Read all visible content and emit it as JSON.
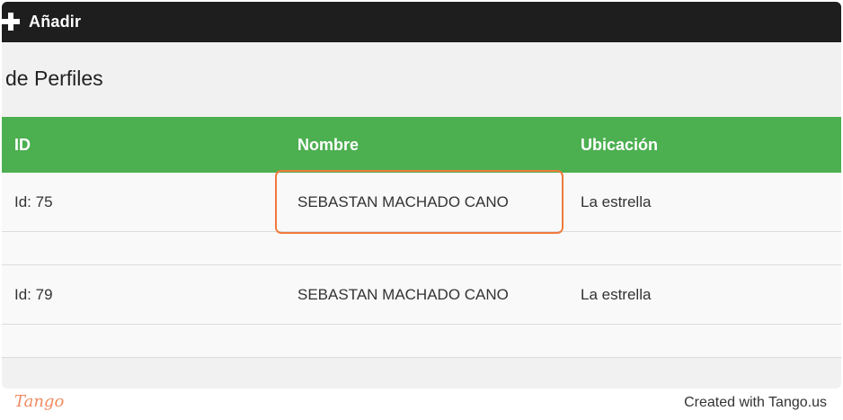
{
  "toolbar": {
    "add_label": "Añadir",
    "add_icon": "plus-icon"
  },
  "page": {
    "title": "de Perfiles"
  },
  "table": {
    "headers": [
      "ID",
      "Nombre",
      "Ubicación"
    ],
    "rows": [
      {
        "id": "Id: 75",
        "name": "SEBASTAN MACHADO CANO",
        "location": "La estrella"
      },
      {
        "id": "Id: 79",
        "name": "SEBASTAN MACHADO CANO",
        "location": "La estrella"
      }
    ]
  },
  "colors": {
    "topbar": "#1e1e1e",
    "header_green": "#4caf50",
    "highlight_orange": "#f07a3c"
  },
  "footer": {
    "logo": "Tango",
    "credit": "Created with Tango.us"
  }
}
